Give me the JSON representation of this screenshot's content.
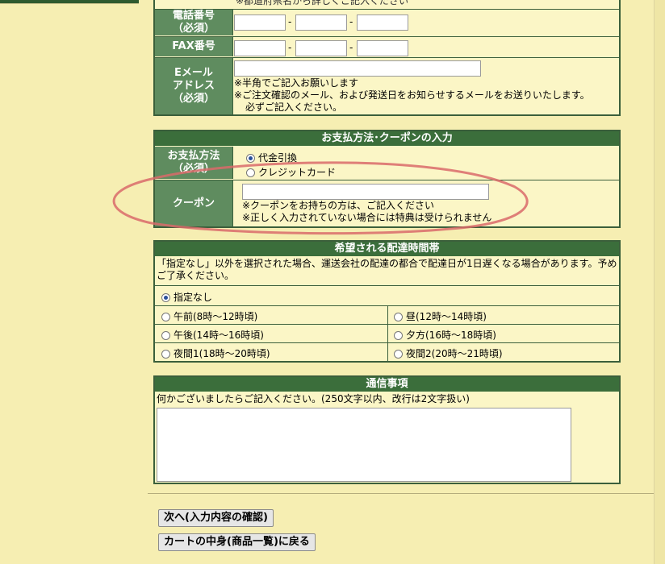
{
  "contact": {
    "top_note": "※都道府県名から詳しくご記入ください",
    "phone_label": "電話番号\n（必須）",
    "fax_label": "FAX番号",
    "email_label": "Eメール\nアドレス\n（必須）",
    "email_note1": "※半角でご記入お願いします",
    "email_note2": "※ご注文確認のメール、および発送日をお知らせするメールをお送りいたします。",
    "email_note3": "必ずご記入ください。",
    "dash": "-"
  },
  "payment": {
    "title": "お支払方法･クーポンの入力",
    "method_label": "お支払方法\n（必須）",
    "options": [
      "代金引換",
      "クレジットカード"
    ],
    "selected": 0,
    "coupon_label": "クーポン",
    "coupon_note1": "※クーポンをお持ちの方は、ご記入ください",
    "coupon_note2": "※正しく入力されていない場合には特典は受けられません"
  },
  "delivery": {
    "title": "希望される配達時間帯",
    "notice": "「指定なし」以外を選択された場合、運送会社の配達の都合で配達日が1日遅くなる場合があります。予め",
    "notice2": "ご了承ください。",
    "none": "指定なし",
    "morning": "午前(8時～12時頃)",
    "noon": "昼(12時～14時頃)",
    "afternoon": "午後(14時～16時頃)",
    "evening": "夕方(16時～18時頃)",
    "night1": "夜間1(18時～20時頃)",
    "night2": "夜間2(20時～21時頃)"
  },
  "message": {
    "title": "通信事項",
    "instruction": "何かございましたらご記入ください。(250文字以内、改行は2文字扱い)"
  },
  "buttons": {
    "next": "次へ(入力内容の確認)",
    "back": "カートの中身(商品一覧)に戻る"
  }
}
